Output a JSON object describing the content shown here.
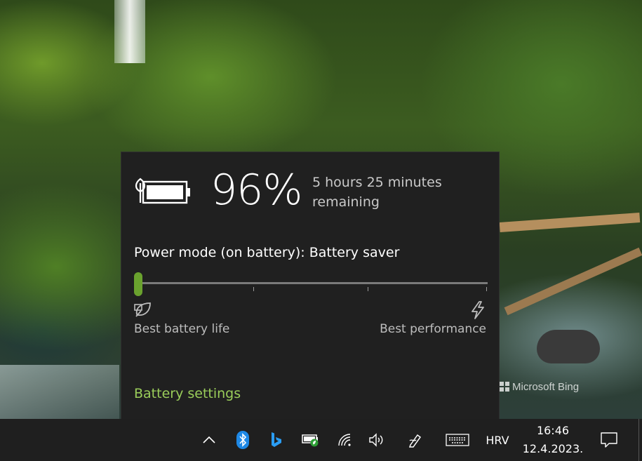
{
  "wallpaper": {
    "watermark": "Microsoft Bing"
  },
  "flyout": {
    "percent": "96%",
    "remaining_line1": "5 hours 25 minutes",
    "remaining_line2": "remaining",
    "power_mode": "Power mode (on battery): Battery saver",
    "slider_value": 0,
    "slider_ticks": 4,
    "label_left": "Best battery life",
    "label_right": "Best performance",
    "settings_link": "Battery settings",
    "accent_color": "#6aa22e",
    "link_color": "#9acd5a",
    "icons": [
      "battery-saver-icon",
      "leaf-icon",
      "lightning-icon"
    ]
  },
  "taskbar": {
    "icons": [
      "chevron-up-icon",
      "bluetooth-icon",
      "bing-icon",
      "battery-icon",
      "wifi-icon",
      "volume-icon",
      "pen-icon",
      "keyboard-icon",
      "notification-icon"
    ],
    "language": "HRV",
    "time": "16:46",
    "date": "12.4.2023."
  }
}
